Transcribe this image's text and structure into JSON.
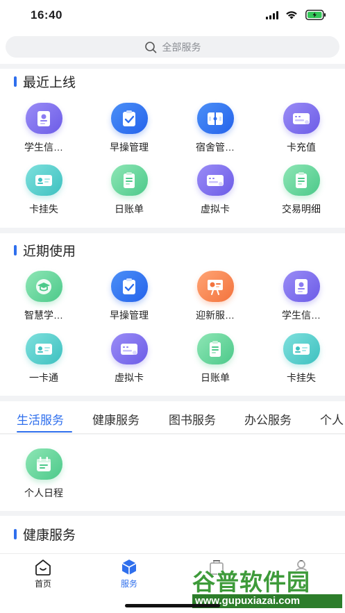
{
  "status_bar": {
    "time": "16:40"
  },
  "search": {
    "placeholder": "全部服务"
  },
  "recent_online": {
    "title": "最近上线",
    "items": [
      {
        "label": "学生信…",
        "icon": "student-id-icon",
        "color": "purple"
      },
      {
        "label": "早操管理",
        "icon": "clipboard-check-icon",
        "color": "blue"
      },
      {
        "label": "宿舍管…",
        "icon": "dorm-icon",
        "color": "blue"
      },
      {
        "label": "卡充值",
        "icon": "card-icon",
        "color": "purple"
      },
      {
        "label": "卡挂失",
        "icon": "id-card-icon",
        "color": "teal"
      },
      {
        "label": "日账单",
        "icon": "bill-icon",
        "color": "green"
      },
      {
        "label": "虚拟卡",
        "icon": "card-icon",
        "color": "purple"
      },
      {
        "label": "交易明细",
        "icon": "bill-icon",
        "color": "green"
      }
    ]
  },
  "recent_used": {
    "title": "近期使用",
    "items": [
      {
        "label": "智慧学…",
        "icon": "graduation-icon",
        "color": "green"
      },
      {
        "label": "早操管理",
        "icon": "clipboard-check-icon",
        "color": "blue"
      },
      {
        "label": "迎新服…",
        "icon": "presentation-icon",
        "color": "orange"
      },
      {
        "label": "学生信…",
        "icon": "student-id-icon",
        "color": "purple"
      },
      {
        "label": "一卡通",
        "icon": "id-card-icon",
        "color": "teal"
      },
      {
        "label": "虚拟卡",
        "icon": "card-icon",
        "color": "purple"
      },
      {
        "label": "日账单",
        "icon": "bill-icon",
        "color": "green"
      },
      {
        "label": "卡挂失",
        "icon": "id-card-icon",
        "color": "teal"
      }
    ]
  },
  "category_tabs": [
    "生活服务",
    "健康服务",
    "图书服务",
    "办公服务",
    "个人"
  ],
  "active_tab": "生活服务",
  "life_services": [
    {
      "label": "个人日程",
      "icon": "calendar-icon",
      "color": "green"
    }
  ],
  "health_section": {
    "title": "健康服务"
  },
  "tabbar": [
    {
      "label": "首页",
      "icon": "home-icon"
    },
    {
      "label": "服务",
      "icon": "cube-icon"
    }
  ],
  "watermark": {
    "text": "谷普软件园",
    "url": "www.gupuxiazai.com"
  },
  "colors": {
    "accent": "#2f6fed",
    "watermark_green": "#3e9b3a"
  }
}
